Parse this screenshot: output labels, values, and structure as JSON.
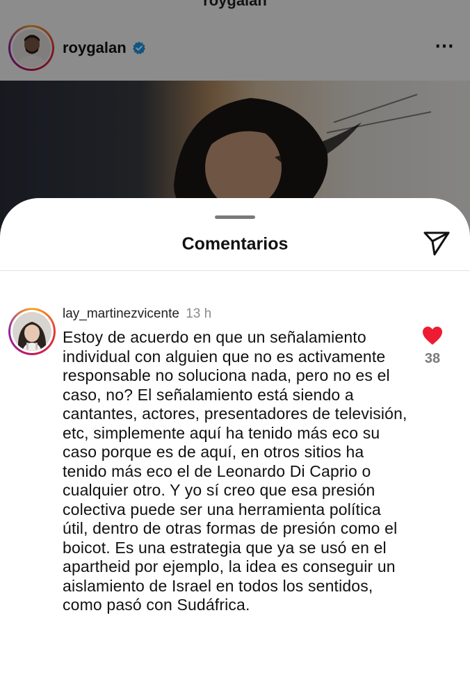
{
  "post": {
    "top_title": "roygalan",
    "username": "roygalan",
    "more_icon": "⋯",
    "verified_color": "#1d9bf0"
  },
  "sheet": {
    "title": "Comentarios"
  },
  "comment": {
    "username": "lay_martinezvicente",
    "time": "13 h",
    "text": "Estoy de acuerdo en que un señalamiento individual con alguien que no es activamente responsable no soluciona nada, pero no es el caso, no? El señalamiento está siendo a cantantes, actores, presentadores de televisión, etc, simplemente aquí ha tenido más eco su caso porque es de aquí, en otros sitios ha tenido más eco el de Leonardo Di Caprio o cualquier otro. Y yo sí creo que esa presión colectiva puede ser una herramienta política útil, dentro de otras formas de presión como el boicot. Es una estrategia que ya se usó en el apartheid por ejemplo, la idea es conseguir un aislamiento de Israel en todos los sentidos, como pasó con Sudáfrica.",
    "like_count": "38",
    "heart_color": "#ed1c33"
  }
}
